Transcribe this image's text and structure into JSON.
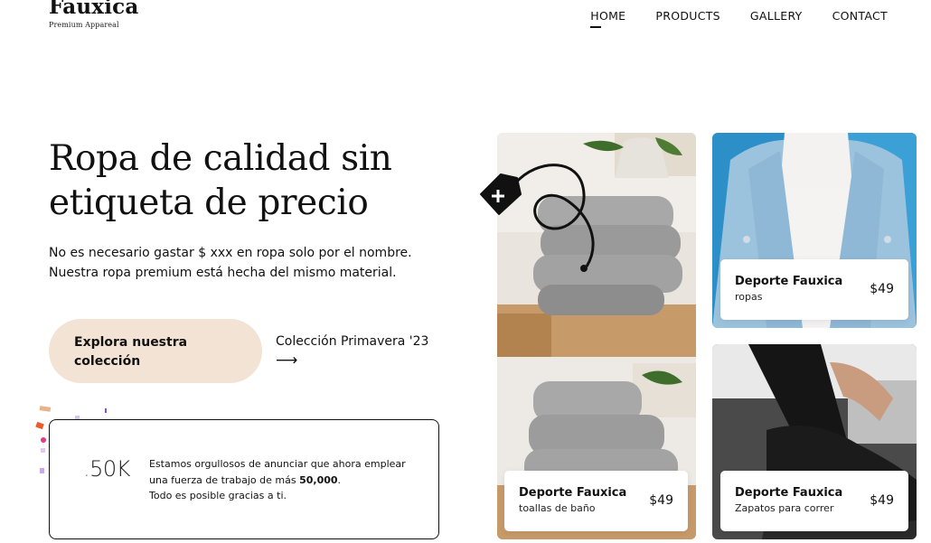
{
  "brand": {
    "name": "Fauxica",
    "tagline": "Premium Appareal"
  },
  "nav": {
    "items": [
      {
        "label": "HOME",
        "active": true
      },
      {
        "label": "PRODUCTS"
      },
      {
        "label": "GALLERY"
      },
      {
        "label": "CONTACT"
      }
    ]
  },
  "hero": {
    "title": "Ropa de calidad sin etiqueta de precio",
    "subtitle": "No es necesario gastar $ xxx en ropa solo por el nombre. Nuestra ropa premium está hecha del mismo material.",
    "cta_label": "Explora nuestra colección",
    "collection_label": "Colección Primavera '23",
    "collection_arrow": "⟶"
  },
  "stats": {
    "number": "50K",
    "text_before": "Estamos orgullosos de anunciar que ahora emplear una fuerza de trabajo de más ",
    "text_bold": "50,000",
    "text_after": ".",
    "text_line2": "Todo es posible gracias a ti."
  },
  "products": [
    {
      "name": "Deporte Fauxica",
      "category": "toallas de baño",
      "price": "$49"
    },
    {
      "name": "Deporte Fauxica",
      "category": "ropas",
      "price": "$49"
    },
    {
      "name": "Deporte Fauxica",
      "category": "Zapatos para correr",
      "price": "$49"
    }
  ],
  "colors": {
    "cta_bg": "#f3e3d4",
    "text": "#111111",
    "accent_purple": "#9b3cf0",
    "card_border": "#111111"
  },
  "icons": {
    "price_tag": "price-tag-icon",
    "arrow": "arrow-right-icon"
  }
}
